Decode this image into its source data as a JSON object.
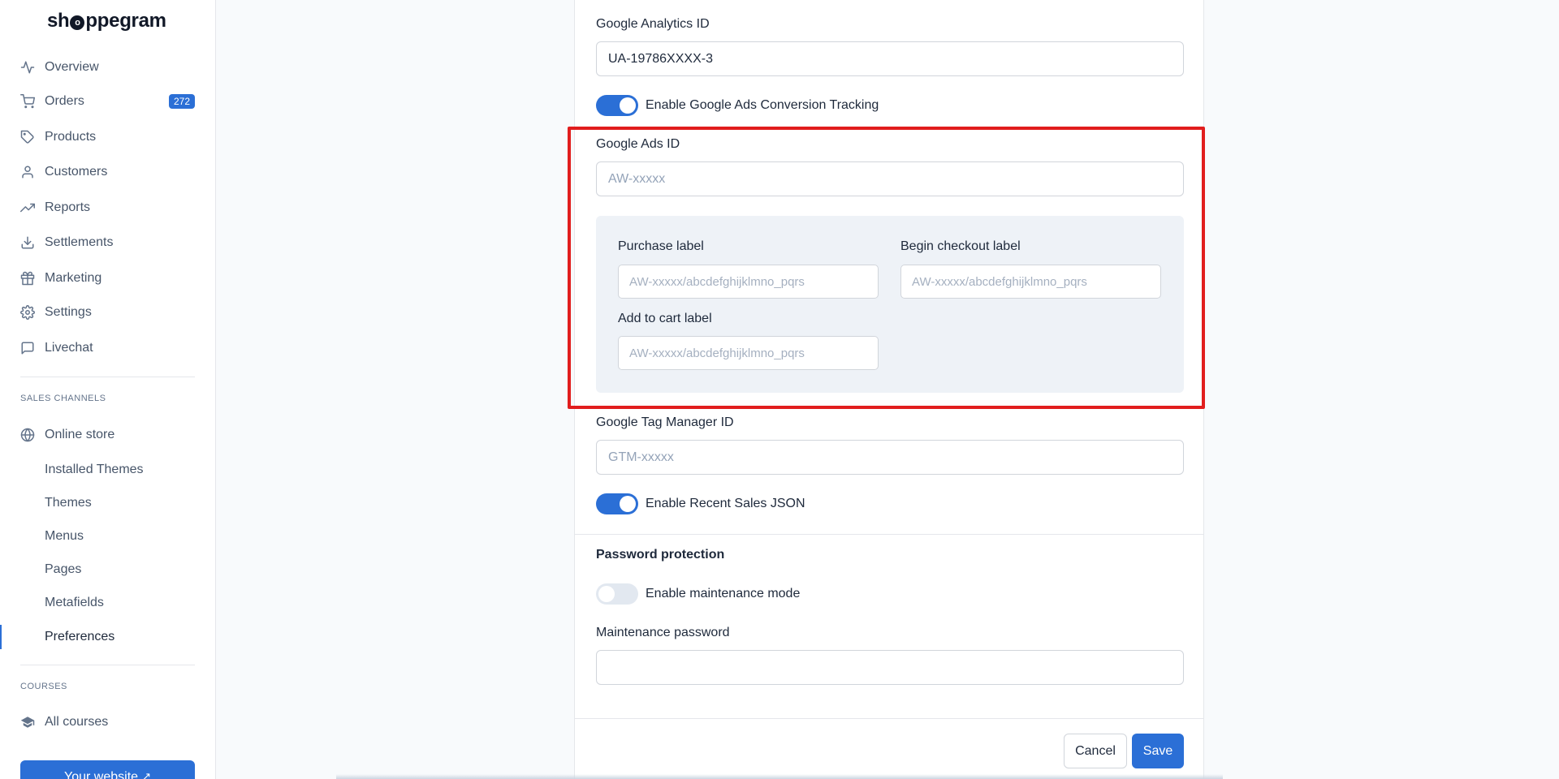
{
  "brand": {
    "name_prefix": "sh",
    "name_mark": "o",
    "name_suffix": "ppegram"
  },
  "sidebar": {
    "items": [
      {
        "label": "Overview",
        "icon": "activity-icon"
      },
      {
        "label": "Orders",
        "icon": "cart-icon",
        "badge": "272"
      },
      {
        "label": "Products",
        "icon": "tag-icon"
      },
      {
        "label": "Customers",
        "icon": "user-icon"
      },
      {
        "label": "Reports",
        "icon": "trending-up-icon"
      },
      {
        "label": "Settlements",
        "icon": "download-icon"
      },
      {
        "label": "Marketing",
        "icon": "gift-icon"
      },
      {
        "label": "Settings",
        "icon": "gear-icon"
      },
      {
        "label": "Livechat",
        "icon": "chat-icon"
      }
    ],
    "sales_channels_label": "SALES CHANNELS",
    "online_store": {
      "label": "Online store",
      "icon": "globe-icon"
    },
    "sub_items": [
      "Installed Themes",
      "Themes",
      "Menus",
      "Pages",
      "Metafields",
      "Preferences"
    ],
    "active_item": "Preferences",
    "courses_label": "COURSES",
    "all_courses": {
      "label": "All courses",
      "icon": "graduation-cap-icon"
    },
    "website_button": "Your website"
  },
  "form": {
    "analytics": {
      "label": "Google Analytics ID",
      "value": "UA-19786XXXX-3"
    },
    "ads_tracking_toggle": {
      "label": "Enable Google Ads Conversion Tracking",
      "on": true
    },
    "ads_id": {
      "label": "Google Ads ID",
      "placeholder": "AW-xxxxx"
    },
    "purchase_label": {
      "label": "Purchase label",
      "placeholder": "AW-xxxxx/abcdefghijklmno_pqrs"
    },
    "begin_checkout_label": {
      "label": "Begin checkout label",
      "placeholder": "AW-xxxxx/abcdefghijklmno_pqrs"
    },
    "add_to_cart_label": {
      "label": "Add to cart label",
      "placeholder": "AW-xxxxx/abcdefghijklmno_pqrs"
    },
    "tag_manager": {
      "label": "Google Tag Manager ID",
      "placeholder": "GTM-xxxxx"
    },
    "recent_sales_toggle": {
      "label": "Enable Recent Sales JSON",
      "on": true
    },
    "password_section_title": "Password protection",
    "maintenance_toggle": {
      "label": "Enable maintenance mode",
      "on": false
    },
    "maintenance_password": {
      "label": "Maintenance password",
      "value": ""
    }
  },
  "actions": {
    "cancel": "Cancel",
    "save": "Save"
  },
  "colors": {
    "accent": "#2b6fd6",
    "highlight": "#e11d1d"
  }
}
